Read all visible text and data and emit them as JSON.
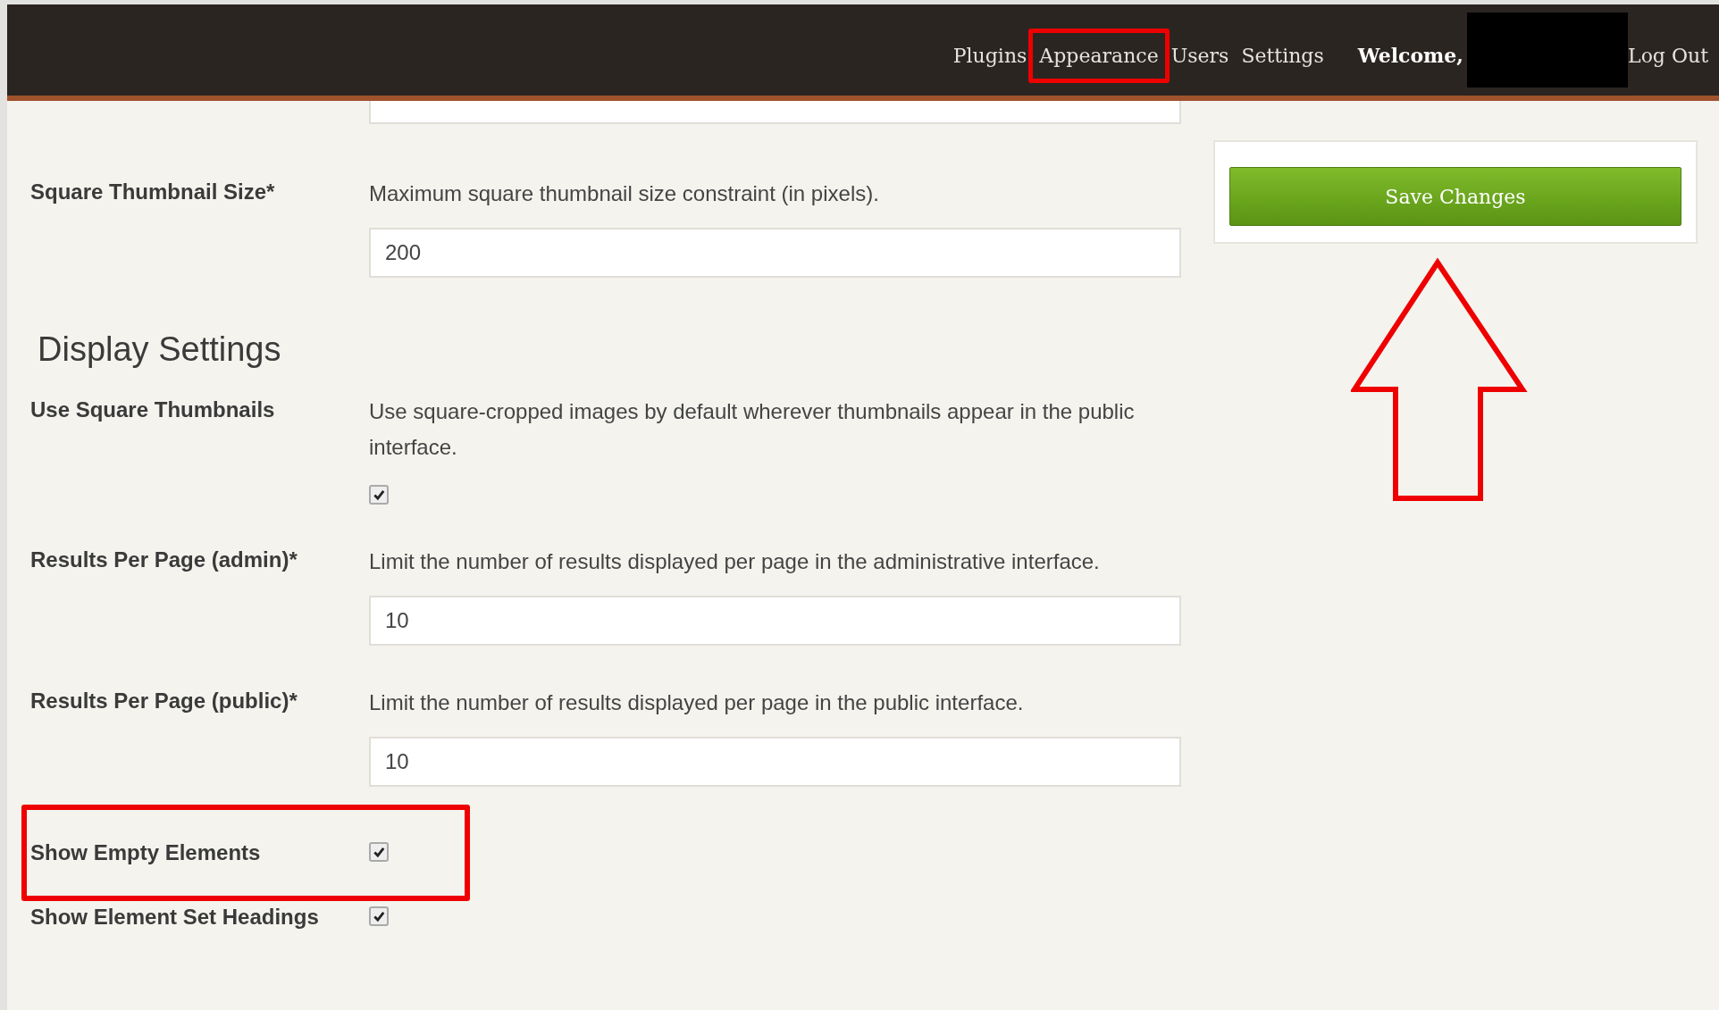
{
  "nav": {
    "items": [
      {
        "label": "Plugins",
        "highlighted": false
      },
      {
        "label": "Appearance",
        "highlighted": true
      },
      {
        "label": "Users",
        "highlighted": false
      },
      {
        "label": "Settings",
        "highlighted": false
      }
    ],
    "welcome": "Welcome,",
    "redacted": true,
    "logout": "Log Out"
  },
  "settings": [
    {
      "kind": "field",
      "label": "Square Thumbnail Size*",
      "description": "Maximum square thumbnail size constraint (in pixels).",
      "value": "200",
      "highlighted": false
    },
    {
      "kind": "heading",
      "label": "Display Settings"
    },
    {
      "kind": "checkbox",
      "label": "Use Square Thumbnails",
      "description": "Use square-cropped images by default wherever thumbnails appear in the public interface.",
      "checked": true,
      "highlighted": false
    },
    {
      "kind": "field",
      "label": "Results Per Page (admin)*",
      "description": "Limit the number of results displayed per page in the administrative interface.",
      "value": "10",
      "highlighted": false
    },
    {
      "kind": "field",
      "label": "Results Per Page (public)*",
      "description": "Limit the number of results displayed per page in the public interface.",
      "value": "10",
      "highlighted": false
    },
    {
      "kind": "checkbox",
      "label": "Show Empty Elements",
      "checked": true,
      "highlighted": true
    },
    {
      "kind": "checkbox",
      "label": "Show Element Set Headings",
      "checked": true,
      "highlighted": false
    }
  ],
  "sidebar": {
    "save_button": "Save Changes",
    "arrow": true
  }
}
